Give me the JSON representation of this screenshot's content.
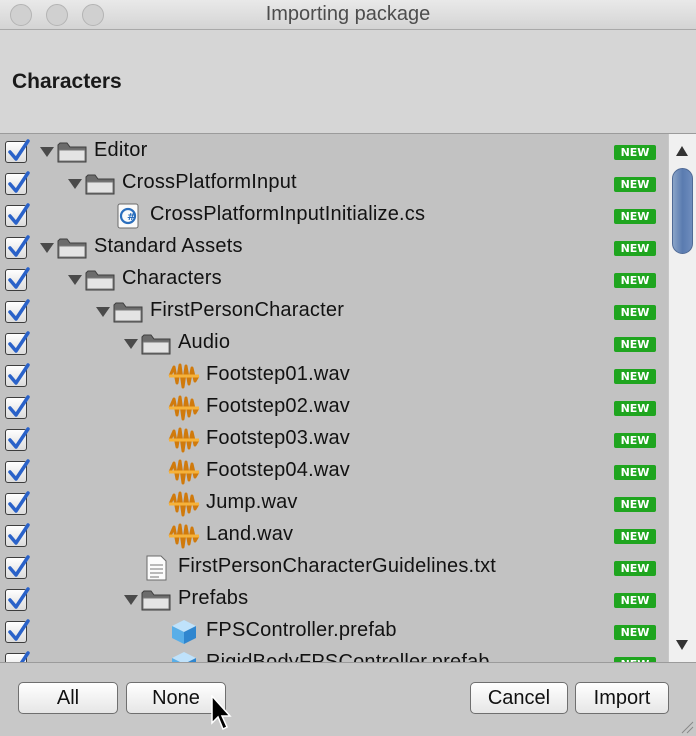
{
  "window": {
    "title": "Importing package"
  },
  "header": {
    "title": "Characters"
  },
  "badge_text": "NEW",
  "tree": [
    {
      "label": "Editor",
      "icon": "folder-icon",
      "depth": 0,
      "expanded": true,
      "checked": true,
      "badge": "NEW"
    },
    {
      "label": "CrossPlatformInput",
      "icon": "folder-icon",
      "depth": 1,
      "expanded": true,
      "checked": true,
      "badge": "NEW"
    },
    {
      "label": "CrossPlatformInputInitialize.cs",
      "icon": "csharp-script-icon",
      "depth": 2,
      "checked": true,
      "badge": "NEW"
    },
    {
      "label": "Standard Assets",
      "icon": "folder-icon",
      "depth": 0,
      "expanded": true,
      "checked": true,
      "badge": "NEW"
    },
    {
      "label": "Characters",
      "icon": "folder-icon",
      "depth": 1,
      "expanded": true,
      "checked": true,
      "badge": "NEW"
    },
    {
      "label": "FirstPersonCharacter",
      "icon": "folder-icon",
      "depth": 2,
      "expanded": true,
      "checked": true,
      "badge": "NEW"
    },
    {
      "label": "Audio",
      "icon": "folder-icon",
      "depth": 3,
      "expanded": true,
      "checked": true,
      "badge": "NEW"
    },
    {
      "label": "Footstep01.wav",
      "icon": "audio-clip-icon",
      "depth": 4,
      "checked": true,
      "badge": "NEW"
    },
    {
      "label": "Footstep02.wav",
      "icon": "audio-clip-icon",
      "depth": 4,
      "checked": true,
      "badge": "NEW"
    },
    {
      "label": "Footstep03.wav",
      "icon": "audio-clip-icon",
      "depth": 4,
      "checked": true,
      "badge": "NEW"
    },
    {
      "label": "Footstep04.wav",
      "icon": "audio-clip-icon",
      "depth": 4,
      "checked": true,
      "badge": "NEW"
    },
    {
      "label": "Jump.wav",
      "icon": "audio-clip-icon",
      "depth": 4,
      "checked": true,
      "badge": "NEW"
    },
    {
      "label": "Land.wav",
      "icon": "audio-clip-icon",
      "depth": 4,
      "checked": true,
      "badge": "NEW"
    },
    {
      "label": "FirstPersonCharacterGuidelines.txt",
      "icon": "text-file-icon",
      "depth": 3,
      "checked": true,
      "badge": "NEW"
    },
    {
      "label": "Prefabs",
      "icon": "folder-icon",
      "depth": 3,
      "expanded": true,
      "checked": true,
      "badge": "NEW"
    },
    {
      "label": "FPSController.prefab",
      "icon": "prefab-icon",
      "depth": 4,
      "checked": true,
      "badge": "NEW"
    },
    {
      "label": "RigidBodyFPSController.prefab",
      "icon": "prefab-icon",
      "depth": 4,
      "checked": true,
      "badge": "NEW"
    }
  ],
  "buttons": {
    "all": "All",
    "none": "None",
    "cancel": "Cancel",
    "import": "Import"
  },
  "colors": {
    "badge": "#1fa51f",
    "checkbox_mark": "#2a62c9",
    "scroll_thumb": "#6e8dbd",
    "window_bg": "#c2c2c2"
  }
}
